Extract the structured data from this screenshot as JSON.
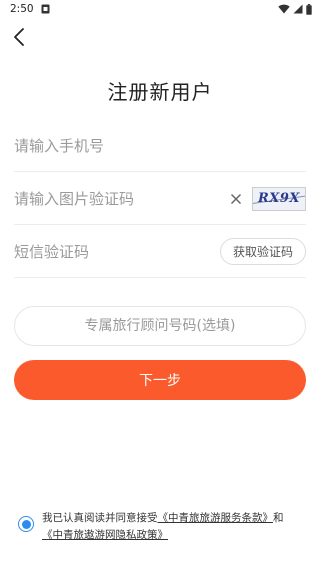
{
  "status_bar": {
    "time": "2:50"
  },
  "header": {
    "title": "注册新用户"
  },
  "form": {
    "phone_placeholder": "请输入手机号",
    "image_code_placeholder": "请输入图片验证码",
    "captcha_text": "RX9X",
    "sms_code_placeholder": "短信验证码",
    "sms_button_label": "获取验证码",
    "advisor_placeholder": "专属旅行顾问号码(选填)",
    "next_button_label": "下一步"
  },
  "agreement": {
    "checked": true,
    "prefix": "我已认真阅读并同意接受",
    "service_terms_link": "《中青旅旅游服务条款》",
    "conjunction": "和",
    "privacy_link": "《中青旅遨游网隐私政策》"
  },
  "colors": {
    "primary_button": "#fb5a2c",
    "radio_accent": "#2d8cf0"
  },
  "icons": [
    "back-arrow-icon",
    "clear-icon",
    "wifi-icon",
    "signal-icon",
    "battery-icon",
    "sim-icon",
    "notification-icon"
  ]
}
